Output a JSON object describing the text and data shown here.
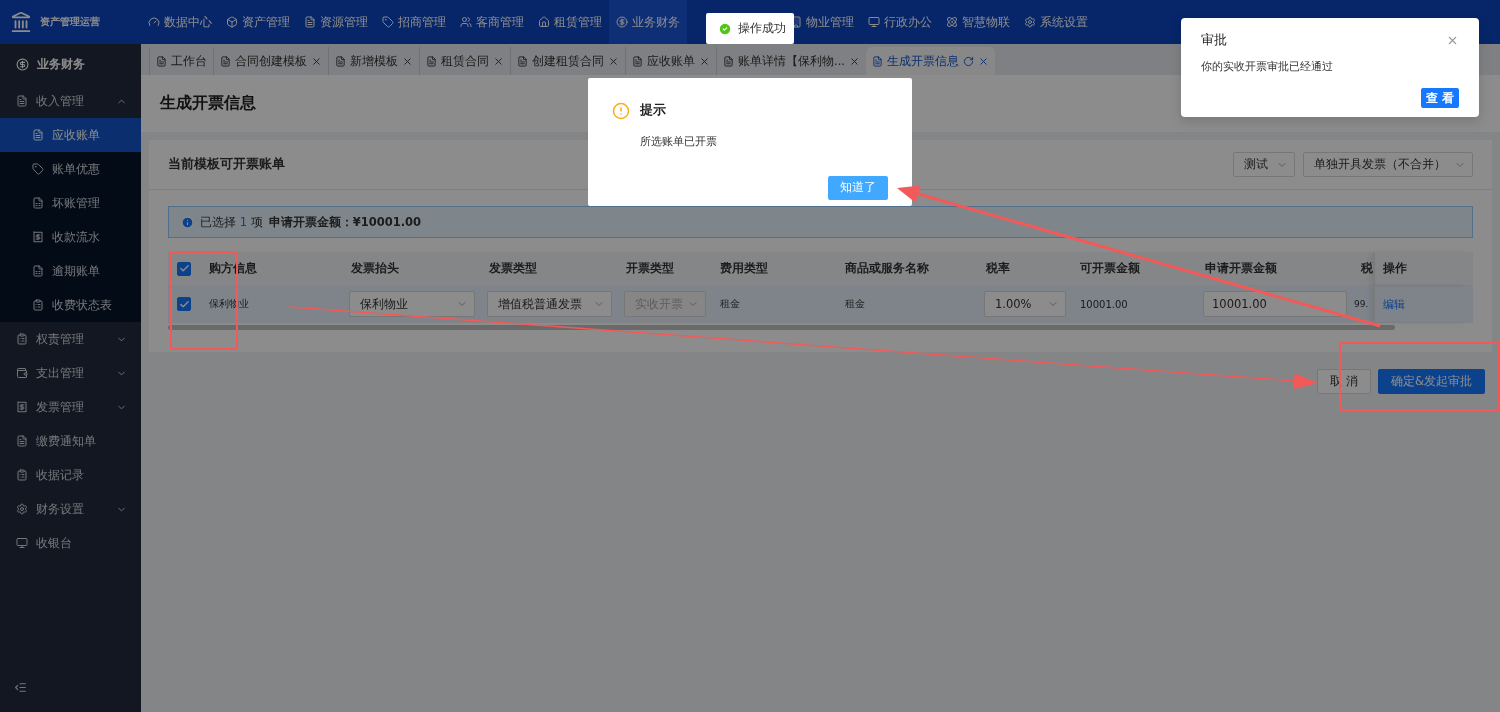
{
  "app": {
    "title": "资产管理运营"
  },
  "nav": [
    {
      "label": "数据中心",
      "selected": false
    },
    {
      "label": "资产管理",
      "selected": false
    },
    {
      "label": "资源管理",
      "selected": false
    },
    {
      "label": "招商管理",
      "selected": false
    },
    {
      "label": "客商管理",
      "selected": false
    },
    {
      "label": "租赁管理",
      "selected": false
    },
    {
      "label": "业务财务",
      "selected": true
    },
    {
      "label": "物业管理",
      "selected": false
    },
    {
      "label": "行政办公",
      "selected": false
    },
    {
      "label": "智慧物联",
      "selected": false
    },
    {
      "label": "系统设置",
      "selected": false
    }
  ],
  "sidebar": {
    "section": "业务财务",
    "items": [
      {
        "label": "收入管理",
        "expanded": true,
        "children": [
          {
            "label": "应收账单",
            "selected": true
          },
          {
            "label": "账单优惠",
            "selected": false
          },
          {
            "label": "坏账管理",
            "selected": false
          },
          {
            "label": "收款流水",
            "selected": false
          },
          {
            "label": "逾期账单",
            "selected": false
          },
          {
            "label": "收费状态表",
            "selected": false
          }
        ]
      },
      {
        "label": "权责管理",
        "expanded": false
      },
      {
        "label": "支出管理",
        "expanded": false
      },
      {
        "label": "发票管理",
        "expanded": false
      },
      {
        "label": "缴费通知单"
      },
      {
        "label": "收据记录"
      },
      {
        "label": "财务设置",
        "expanded": false
      },
      {
        "label": "收银台"
      }
    ]
  },
  "tabs": [
    {
      "label": "工作台",
      "selected": false,
      "closable": false
    },
    {
      "label": "合同创建模板",
      "selected": false,
      "closable": true
    },
    {
      "label": "新增模板",
      "selected": false,
      "closable": true
    },
    {
      "label": "租赁合同",
      "selected": false,
      "closable": true
    },
    {
      "label": "创建租赁合同",
      "selected": false,
      "closable": true
    },
    {
      "label": "应收账单",
      "selected": false,
      "closable": true
    },
    {
      "label": "账单详情【保利物...",
      "selected": false,
      "closable": true
    },
    {
      "label": "生成开票信息",
      "selected": true,
      "closable": true
    }
  ],
  "page": {
    "title": "生成开票信息"
  },
  "card": {
    "title": "当前模板可开票账单",
    "selects": [
      {
        "value": "测试"
      },
      {
        "value": "单独开具发票（不合并）"
      }
    ],
    "alert": {
      "prefix": "已选择",
      "count": "1",
      "unit": "项",
      "amount_label": "申请开票金额：¥10001.00"
    },
    "table": {
      "columns": [
        "购方信息",
        "发票抬头",
        "发票类型",
        "开票类型",
        "费用类型",
        "商品或服务名称",
        "税率",
        "可开票金额",
        "申请开票金额",
        "税",
        "操作"
      ],
      "all_checked": true,
      "rows": [
        {
          "checked": true,
          "buyer": "保利物业",
          "title": "保利物业",
          "invoice_type": "增值税普通发票",
          "billing_type": "实收开票",
          "billing_type_disabled": true,
          "fee_type": "租金",
          "service_name": "租金",
          "tax_rate": "1.00%",
          "available": "10001.00",
          "requested": "10001.00",
          "column_10": "99.",
          "action": "编辑"
        }
      ]
    }
  },
  "buttons": {
    "cancel": "取 消",
    "confirm": "确定&发起审批"
  },
  "toast": {
    "text": "操作成功"
  },
  "modal": {
    "title": "提示",
    "message": "所选账单已开票",
    "button": "知道了"
  },
  "notification": {
    "title": "审批",
    "message": "你的实收开票审批已经通过",
    "button": "查 看"
  }
}
